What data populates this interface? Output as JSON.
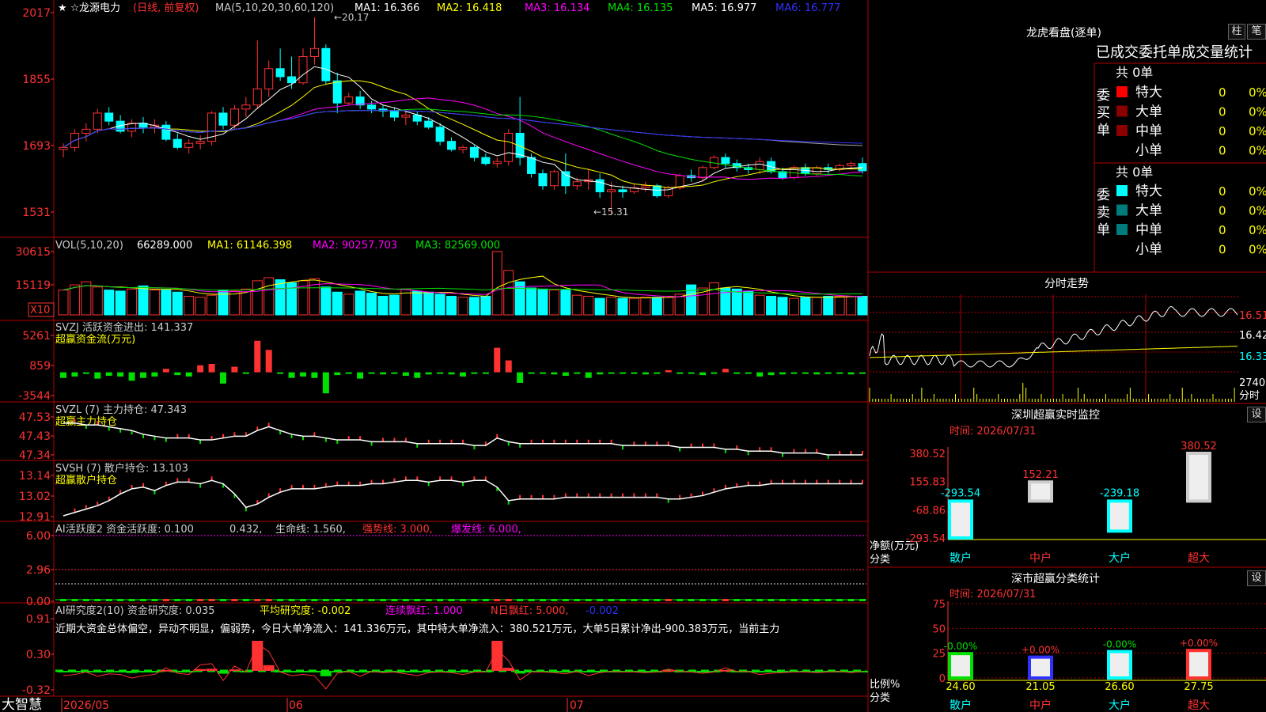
{
  "colors": {
    "up": "#ff3232",
    "down": "#00ffff",
    "red": "#ff3232",
    "cyan": "#00ffff",
    "green": "#00e000",
    "yellow": "#ffff00",
    "magenta": "#ff00ff",
    "white": "#ffffff",
    "grid": "#b00000",
    "blue": "#3030ff"
  },
  "stock": {
    "name": "龙源电力",
    "period": "(日线, 前复权)",
    "ma_param": "MA(5,10,20,30,60,120)",
    "ma1": "MA1: 16.366",
    "ma2": "MA2: 16.418",
    "ma3": "MA3: 16.134",
    "ma4": "MA4: 16.135",
    "ma5": "MA5: 16.977",
    "ma6": "MA6: 16.777",
    "high_mark": "←20.17",
    "low_mark": "←15.31"
  },
  "price_axis": {
    "ticks": [
      "2017",
      "1855",
      "1693",
      "1531"
    ]
  },
  "vol": {
    "header": "VOL(5,10,20)",
    "value": "66289.000",
    "ma1": "MA1: 61146.398",
    "ma2": "MA2: 90257.703",
    "ma3": "MA3: 82569.000",
    "ticks": [
      "30615",
      "15119"
    ],
    "unit": "X10"
  },
  "svzj": {
    "header": "SVZJ  活跃资金进出: 141.337",
    "label": "超赢资金流(万元)",
    "ticks": [
      "5261",
      "859",
      "-3544"
    ]
  },
  "svzl": {
    "header": "SVZL (7) 主力持仓: 47.343",
    "label": "超赢主力持仓",
    "ticks": [
      "47.53",
      "47.43",
      "47.34"
    ]
  },
  "svsh": {
    "header": "SVSH (7) 散户持仓: 13.103",
    "label": "超赢散户持仓",
    "ticks": [
      "13.14",
      "13.02",
      "12.91"
    ]
  },
  "ai1": {
    "p1": "AI活跃度2 资金活跃度: 0.100",
    "p2": "0.432,",
    "p3": "生命线: 1.560,",
    "p4": "强势线: 3.000,",
    "p5": "爆发线: 6.000,",
    "ticks": [
      "6.00",
      "2.96",
      "0.00"
    ]
  },
  "ai2": {
    "p1": "AI研究度2(10) 资金研究度: 0.035",
    "p2": "平均研究度: -0.002",
    "p3": "连续飘红: 1.000",
    "p4": "N日飘红: 5.000,",
    "p5": "-0.002",
    "summary": "近期大资金总体偏空，异动不明显，偏弱势，今日大单净流入：141.336万元，其中特大单净流入：380.521万元，大单5日累计净出-900.383万元，当前主力",
    "ticks": [
      "0.91",
      "0.30",
      "-0.32"
    ]
  },
  "bottom": {
    "brand": "大智慧",
    "dates": [
      "2026/05",
      "06",
      "07"
    ]
  },
  "lhkp": {
    "title": "龙虎看盘(逐单)",
    "btn1": "柱",
    "btn2": "笔",
    "tabs": "已成交委托单成交量统计",
    "buy_total": "共 0单",
    "sell_total": "共 0单",
    "buy_label": "委买单",
    "sell_label": "委卖单",
    "buy_rows": [
      {
        "name": "特大",
        "count": "0",
        "pct": "0%"
      },
      {
        "name": "大单",
        "count": "0",
        "pct": "0%"
      },
      {
        "name": "中单",
        "count": "0",
        "pct": "0%"
      },
      {
        "name": "小单",
        "count": "0",
        "pct": "0%"
      }
    ],
    "sell_rows": [
      {
        "name": "特大",
        "count": "0",
        "pct": "0%"
      },
      {
        "name": "大单",
        "count": "0",
        "pct": "0%"
      },
      {
        "name": "中单",
        "count": "0",
        "pct": "0%"
      },
      {
        "name": "小单",
        "count": "0",
        "pct": "0%"
      }
    ]
  },
  "fenshi": {
    "title": "分时走势",
    "ticks": [
      "16.51",
      "16.42",
      "16.33"
    ],
    "vol_tick": "2740",
    "vol_unit": "分时"
  },
  "szmon": {
    "title": "深圳超赢实时监控",
    "btn": "设",
    "time": "时间: 2026/07/31",
    "ticks": [
      "380.52",
      "155.83",
      "-68.86",
      "-293.54"
    ],
    "ylabel": "净额(万元)",
    "xlabel": "分类"
  },
  "szcls": {
    "title": "深市超赢分类统计",
    "btn": "设",
    "time": "时间: 2026/07/31",
    "ticks": [
      "75",
      "50",
      "25",
      "0"
    ],
    "ylabel": "比例%",
    "xlabel": "分类"
  },
  "chart_data": [
    {
      "type": "candlestick",
      "title": "龙源电力",
      "ylim": [
        15.31,
        20.17
      ],
      "note": "OHLC per day",
      "ohlc": [
        [
          16.9,
          17.05,
          16.7,
          16.95
        ],
        [
          16.95,
          17.4,
          16.85,
          17.3
        ],
        [
          17.3,
          17.55,
          17.1,
          17.4
        ],
        [
          17.4,
          17.9,
          17.3,
          17.8
        ],
        [
          17.8,
          17.95,
          17.5,
          17.6
        ],
        [
          17.6,
          17.75,
          17.3,
          17.35
        ],
        [
          17.35,
          17.65,
          17.2,
          17.55
        ],
        [
          17.55,
          17.7,
          17.3,
          17.45
        ],
        [
          17.45,
          17.65,
          17.3,
          17.5
        ],
        [
          17.5,
          17.6,
          17.1,
          17.15
        ],
        [
          17.15,
          17.3,
          16.9,
          16.95
        ],
        [
          16.95,
          17.15,
          16.8,
          17.05
        ],
        [
          17.05,
          17.25,
          16.9,
          17.1
        ],
        [
          17.1,
          17.85,
          17.0,
          17.8
        ],
        [
          17.8,
          17.95,
          17.4,
          17.5
        ],
        [
          17.5,
          18.0,
          17.4,
          17.9
        ],
        [
          17.9,
          18.2,
          17.7,
          18.0
        ],
        [
          18.0,
          19.6,
          17.9,
          18.4
        ],
        [
          18.4,
          19.1,
          18.2,
          18.9
        ],
        [
          18.9,
          19.4,
          18.6,
          18.7
        ],
        [
          18.7,
          19.2,
          18.4,
          18.55
        ],
        [
          18.55,
          19.4,
          18.5,
          19.2
        ],
        [
          19.2,
          20.17,
          19.0,
          19.4
        ],
        [
          19.4,
          19.5,
          18.5,
          18.6
        ],
        [
          18.6,
          18.8,
          17.8,
          18.05
        ],
        [
          18.05,
          18.3,
          18.0,
          18.2
        ],
        [
          18.2,
          18.35,
          17.9,
          18.0
        ],
        [
          18.0,
          18.1,
          17.8,
          17.9
        ],
        [
          17.9,
          18.0,
          17.7,
          17.85
        ],
        [
          17.85,
          17.95,
          17.6,
          17.7
        ],
        [
          17.7,
          17.9,
          17.5,
          17.75
        ],
        [
          17.75,
          17.85,
          17.5,
          17.6
        ],
        [
          17.6,
          17.7,
          17.4,
          17.45
        ],
        [
          17.45,
          17.55,
          17.0,
          17.1
        ],
        [
          17.1,
          17.2,
          16.85,
          16.9
        ],
        [
          16.9,
          17.0,
          16.8,
          16.95
        ],
        [
          16.95,
          17.0,
          16.6,
          16.7
        ],
        [
          16.7,
          16.8,
          16.5,
          16.55
        ],
        [
          16.55,
          16.7,
          16.45,
          16.6
        ],
        [
          16.6,
          17.4,
          16.5,
          17.3
        ],
        [
          17.3,
          18.2,
          16.5,
          16.7
        ],
        [
          16.7,
          16.8,
          16.2,
          16.3
        ],
        [
          16.3,
          16.4,
          15.9,
          16.0
        ],
        [
          16.0,
          16.4,
          15.9,
          16.35
        ],
        [
          16.35,
          16.8,
          15.8,
          16.0
        ],
        [
          16.0,
          16.2,
          15.9,
          16.1
        ],
        [
          16.1,
          16.4,
          15.9,
          16.15
        ],
        [
          16.15,
          16.3,
          15.7,
          15.85
        ],
        [
          15.85,
          16.1,
          15.31,
          15.9
        ],
        [
          15.9,
          16.0,
          15.7,
          15.85
        ],
        [
          15.85,
          16.05,
          15.8,
          15.95
        ],
        [
          15.95,
          16.1,
          15.85,
          16.0
        ],
        [
          16.0,
          16.05,
          15.7,
          15.75
        ],
        [
          15.75,
          16.0,
          15.7,
          15.95
        ],
        [
          15.95,
          16.3,
          15.9,
          16.25
        ],
        [
          16.25,
          16.4,
          16.1,
          16.2
        ],
        [
          16.2,
          16.5,
          16.1,
          16.45
        ],
        [
          16.45,
          16.75,
          16.4,
          16.7
        ],
        [
          16.7,
          16.8,
          16.45,
          16.55
        ],
        [
          16.55,
          16.65,
          16.35,
          16.45
        ],
        [
          16.45,
          16.55,
          16.3,
          16.4
        ],
        [
          16.4,
          16.7,
          16.3,
          16.6
        ],
        [
          16.6,
          16.7,
          16.3,
          16.35
        ],
        [
          16.35,
          16.45,
          16.15,
          16.2
        ],
        [
          16.2,
          16.5,
          16.15,
          16.45
        ],
        [
          16.45,
          16.55,
          16.25,
          16.3
        ],
        [
          16.3,
          16.5,
          16.25,
          16.45
        ],
        [
          16.45,
          16.55,
          16.3,
          16.4
        ],
        [
          16.4,
          16.55,
          16.35,
          16.5
        ],
        [
          16.5,
          16.6,
          16.4,
          16.55
        ],
        [
          16.55,
          16.7,
          16.3,
          16.37
        ]
      ]
    },
    {
      "type": "bar",
      "title": "VOL(5,10,20)",
      "ylim": [
        0,
        30615
      ],
      "values": [
        12000,
        14500,
        16000,
        13500,
        12000,
        11500,
        12500,
        14000,
        12000,
        12000,
        11000,
        9000,
        8500,
        9500,
        12000,
        11500,
        12500,
        16500,
        18000,
        17000,
        15500,
        16500,
        17500,
        13500,
        11000,
        10000,
        11500,
        10500,
        9000,
        9500,
        12500,
        11500,
        11000,
        10000,
        9000,
        8500,
        8500,
        9000,
        30615,
        21500,
        16000,
        13000,
        12500,
        12000,
        12000,
        9500,
        9000,
        8000,
        8500,
        8000,
        8000,
        8500,
        8500,
        9000,
        10000,
        14500,
        13000,
        15500,
        13000,
        12500,
        11500,
        9500,
        9000,
        8500,
        8000,
        8500,
        8500,
        9000,
        9000,
        9000,
        9000
      ]
    },
    {
      "type": "bar",
      "title": "SVZJ",
      "ylim": [
        -3544,
        5261
      ],
      "values": [
        -800,
        -600,
        -200,
        -900,
        -500,
        -600,
        -1200,
        -800,
        -600,
        500,
        -400,
        -600,
        1000,
        1200,
        -1600,
        800,
        -200,
        4500,
        3200,
        -200,
        -800,
        -600,
        -800,
        -3000,
        -400,
        -100,
        -900,
        -100,
        -300,
        -200,
        -500,
        -800,
        -300,
        -200,
        -300,
        -600,
        -200,
        -200,
        3500,
        1700,
        -1500,
        -200,
        -200,
        -300,
        -500,
        -100,
        -800,
        -300,
        -100,
        -200,
        -200,
        -300,
        -200,
        300,
        -100,
        -200,
        -400,
        -200,
        500,
        -100,
        -100,
        -600,
        -400,
        -300,
        -200,
        -200,
        -300,
        -200,
        -100,
        -300,
        -100
      ]
    },
    {
      "type": "line",
      "title": "SVZL",
      "ylim": [
        47.34,
        47.53
      ],
      "values": [
        47.51,
        47.51,
        47.5,
        47.5,
        47.49,
        47.48,
        47.47,
        47.45,
        47.44,
        47.43,
        47.43,
        47.43,
        47.42,
        47.42,
        47.43,
        47.44,
        47.44,
        47.47,
        47.49,
        47.47,
        47.45,
        47.44,
        47.44,
        47.43,
        47.42,
        47.42,
        47.42,
        47.41,
        47.41,
        47.41,
        47.41,
        47.4,
        47.4,
        47.4,
        47.4,
        47.4,
        47.39,
        47.39,
        47.43,
        47.41,
        47.4,
        47.4,
        47.4,
        47.4,
        47.4,
        47.4,
        47.4,
        47.4,
        47.4,
        47.39,
        47.39,
        47.39,
        47.39,
        47.39,
        47.38,
        47.38,
        47.38,
        47.38,
        47.37,
        47.37,
        47.36,
        47.36,
        47.36,
        47.35,
        47.35,
        47.35,
        47.35,
        47.34,
        47.34,
        47.34,
        47.34
      ]
    },
    {
      "type": "line",
      "title": "SVSH",
      "ylim": [
        12.91,
        13.14
      ],
      "values": [
        12.91,
        12.93,
        12.95,
        12.97,
        13.0,
        13.04,
        13.07,
        13.08,
        13.06,
        13.09,
        13.11,
        13.11,
        13.1,
        13.12,
        13.1,
        13.04,
        12.96,
        12.98,
        13.02,
        13.05,
        13.07,
        13.07,
        13.07,
        13.08,
        13.09,
        13.09,
        13.09,
        13.1,
        13.1,
        13.11,
        13.12,
        13.12,
        13.11,
        13.12,
        13.12,
        13.11,
        13.12,
        13.12,
        13.08,
        13.0,
        13.01,
        13.01,
        13.01,
        13.01,
        13.02,
        13.02,
        13.02,
        13.02,
        13.02,
        13.02,
        13.02,
        13.02,
        13.02,
        13.01,
        13.01,
        13.02,
        13.03,
        13.05,
        13.07,
        13.08,
        13.09,
        13.09,
        13.1,
        13.1,
        13.1,
        13.1,
        13.1,
        13.1,
        13.1,
        13.1,
        13.1
      ]
    },
    {
      "type": "line",
      "title": "分时走势",
      "ylim": [
        16.33,
        16.51
      ],
      "note": "intraday price"
    },
    {
      "type": "bar",
      "title": "深圳超赢实时监控",
      "categories": [
        "散户",
        "中户",
        "大户",
        "超大"
      ],
      "values": [
        -293.54,
        152.21,
        -239.18,
        380.52
      ],
      "ylim": [
        -293.54,
        380.52
      ]
    },
    {
      "type": "bar",
      "title": "深市超赢分类统计",
      "categories": [
        "散户",
        "中户",
        "大户",
        "超大"
      ],
      "values": [
        24.6,
        21.05,
        26.6,
        27.75
      ],
      "changes": [
        "-0.00%",
        "+0.00%",
        "-0.00%",
        "+0.00%"
      ],
      "ylim": [
        0,
        75
      ]
    }
  ]
}
